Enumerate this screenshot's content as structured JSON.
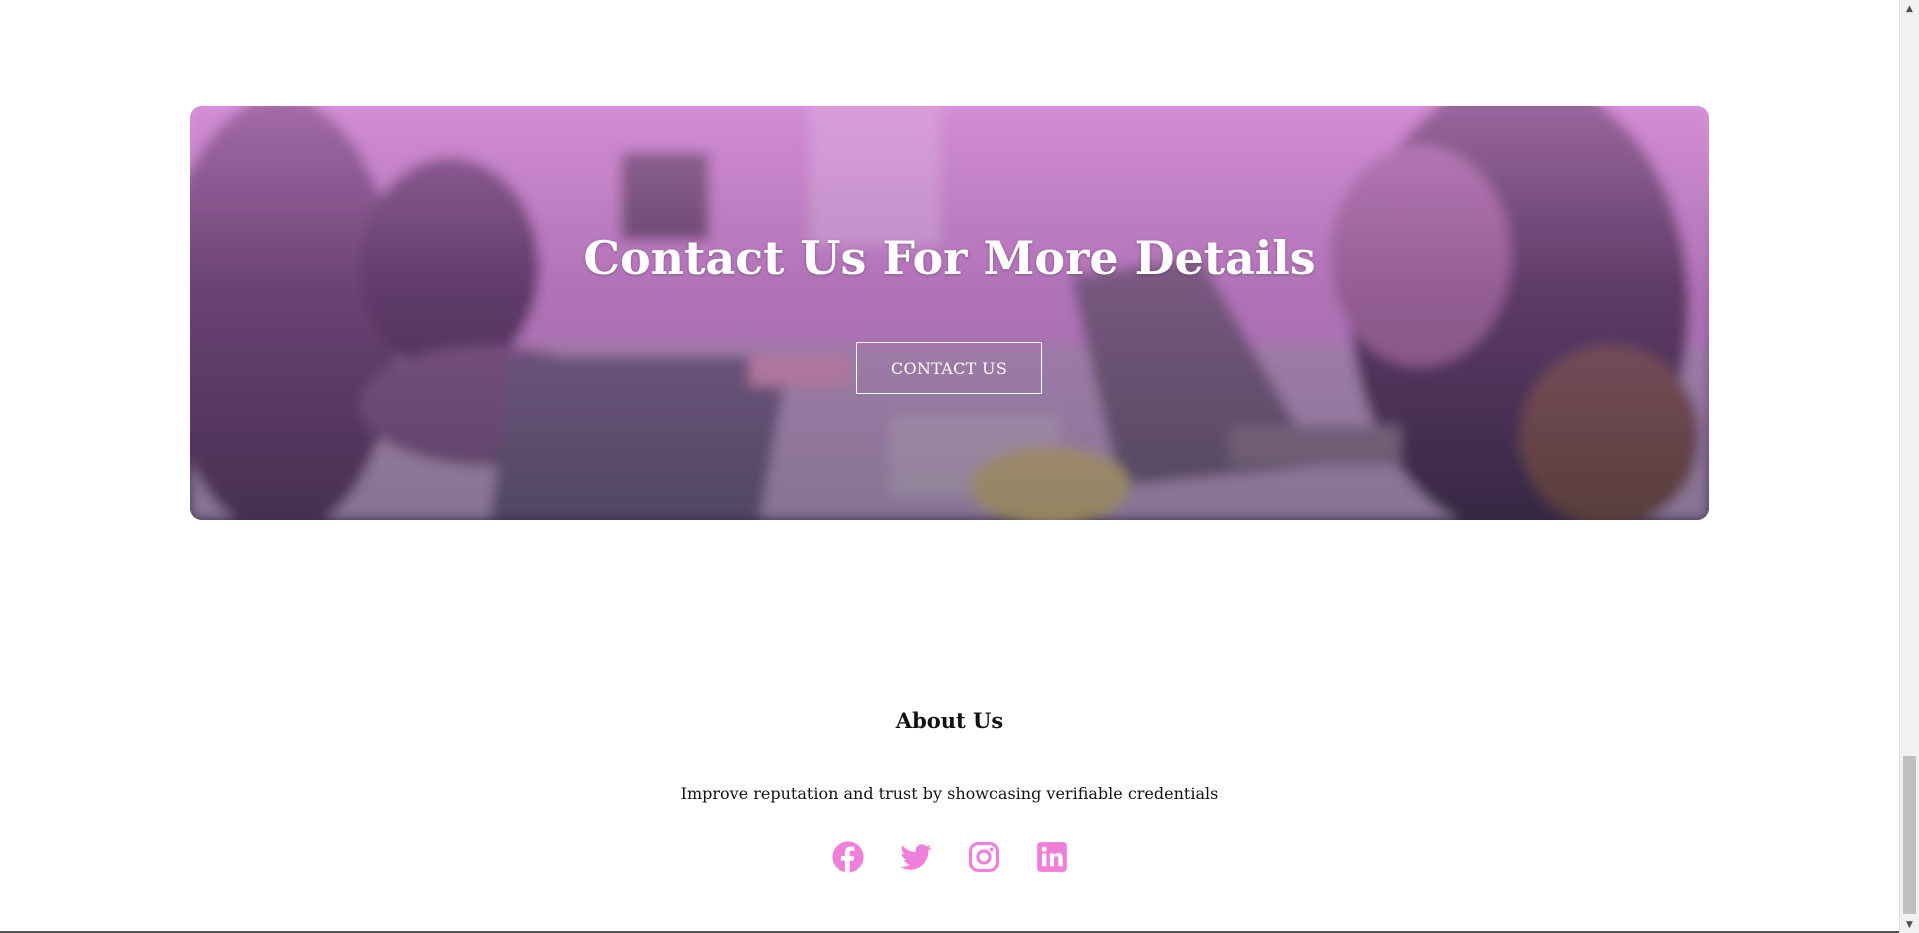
{
  "banner": {
    "title": "Contact Us For More Details",
    "button_label": "CONTACT US"
  },
  "footer": {
    "title": "About Us",
    "text": "Improve reputation and trust by showcasing verifiable credentials",
    "socials": [
      {
        "icon": "facebook-icon"
      },
      {
        "icon": "twitter-icon"
      },
      {
        "icon": "instagram-icon"
      },
      {
        "icon": "linkedin-icon"
      }
    ]
  },
  "scrollbar": {
    "up_arrow": "▲",
    "down_arrow": "▼"
  },
  "colors": {
    "accent": "#f07fdc",
    "banner_tint": "#d99ad9",
    "text": "#111111"
  }
}
